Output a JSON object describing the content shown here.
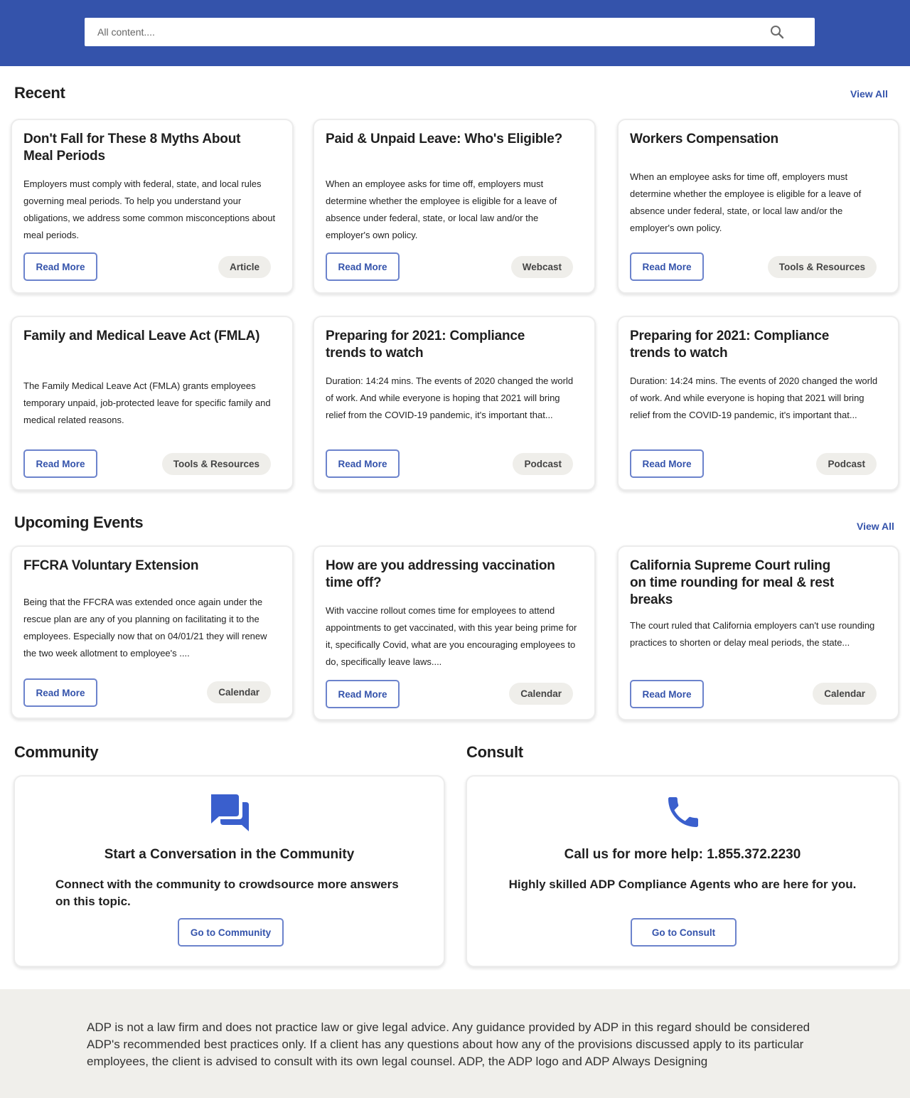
{
  "search": {
    "placeholder": "All content...."
  },
  "recent": {
    "title": "Recent",
    "view_all": "View All",
    "cards": [
      {
        "title": "Don't Fall for These 8 Myths About Meal Periods",
        "desc": "Employers must comply with federal, state, and local rules governing meal periods. To help you understand your obligations, we address some common misconceptions about meal periods.",
        "button": "Read More",
        "badge": "Article"
      },
      {
        "title": "Paid & Unpaid Leave: Who's Eligible?",
        "desc": "When an employee asks for time off, employers must determine whether the employee is eligible for a leave of absence under federal, state, or local law and/or the employer's own policy.",
        "button": "Read More",
        "badge": "Webcast"
      },
      {
        "title": "Workers Compensation",
        "desc": "When an employee asks for time off, employers must determine whether the employee is eligible for a leave of absence under federal, state, or local law and/or the employer's own policy.",
        "button": "Read More",
        "badge": "Tools & Resources"
      },
      {
        "title": "Family and Medical Leave Act (FMLA)",
        "desc": "The Family Medical Leave Act (FMLA) grants employees temporary unpaid, job-protected leave for specific family and medical related reasons.",
        "button": "Read More",
        "badge": "Tools & Resources"
      },
      {
        "title": "Preparing for 2021: Compliance trends to watch",
        "desc": "Duration: 14:24 mins. The events of 2020 changed the world of work. And while everyone is hoping that 2021 will bring relief from the COVID-19 pandemic, it's important that...",
        "button": "Read More",
        "badge": "Podcast"
      },
      {
        "title": "Preparing for 2021: Compliance trends to watch",
        "desc": "Duration: 14:24 mins. The events of 2020 changed the world of work. And while everyone is hoping that 2021 will bring relief from the COVID-19 pandemic, it's important that...",
        "button": "Read More",
        "badge": "Podcast"
      }
    ]
  },
  "events": {
    "title": "Upcoming Events",
    "view_all": "View All",
    "cards": [
      {
        "title": "FFCRA Voluntary Extension",
        "desc": "Being that the FFCRA was extended once again under the rescue plan are any of you planning on facilitating it to the employees. Especially now that on 04/01/21 they will renew the two week allotment to employee's ....",
        "button": "Read More",
        "badge": "Calendar"
      },
      {
        "title": "How are you addressing vaccination time off?",
        "desc": "With vaccine rollout comes time for employees to attend appointments to get vaccinated, with this year being prime for it, specifically Covid, what are you encouraging employees to do, specifically leave laws....",
        "button": "Read More",
        "badge": "Calendar"
      },
      {
        "title": "California Supreme Court ruling on time rounding for meal & rest breaks",
        "desc": "The court ruled that California employers can't use rounding practices to shorten or delay meal periods, the state...",
        "button": "Read More",
        "badge": "Calendar"
      }
    ]
  },
  "community": {
    "title": "Community",
    "icon": "chat-icon",
    "heading": "Start a Conversation in the Community",
    "desc": "Connect with the community to crowdsource more answers on this topic.",
    "button": "Go to Community"
  },
  "consult": {
    "title": "Consult",
    "icon": "phone-icon",
    "heading": "Call us for more help: 1.855.372.2230",
    "desc": "Highly skilled ADP Compliance Agents who are here for you.",
    "button": "Go to Consult"
  },
  "footer": {
    "disclaimer": "ADP is not a law firm and does not practice law or give legal advice. Any guidance provided by ADP in this regard should be considered ADP's recommended best practices only. If a client has any questions about how any of the provisions discussed apply to its particular employees, the client is advised to consult with its own legal counsel. ADP, the ADP logo and ADP Always Designing"
  },
  "colors": {
    "brand": "#3453ab",
    "icon": "#3a5fcd",
    "badge_bg": "#efeeea",
    "footer_bg": "#f0efeb"
  }
}
